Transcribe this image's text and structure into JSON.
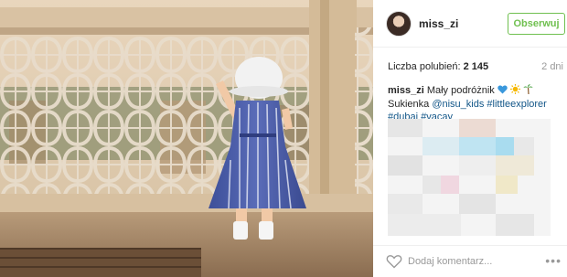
{
  "post": {
    "username": "miss_zi",
    "follow_label": "Obserwuj",
    "likes_label": "Liczba polubień:",
    "likes_count": "2 145",
    "time_ago": "2 dni"
  },
  "caption": {
    "username": "miss_zi",
    "text": "Mały podróżnik",
    "line2_prefix": "Sukienka",
    "mention": "@nisu_kids",
    "tag1": "#littleexplorer",
    "tag2": "#dubai",
    "tag3": "#vacay",
    "emojis": [
      "blue-heart",
      "sun",
      "palm-tree"
    ]
  },
  "comment": {
    "placeholder": "Dodaj komentarz..."
  },
  "more_label": "•••",
  "colors": {
    "follow_green": "#70c050",
    "link_blue": "#125688",
    "muted_gray": "#999999"
  }
}
